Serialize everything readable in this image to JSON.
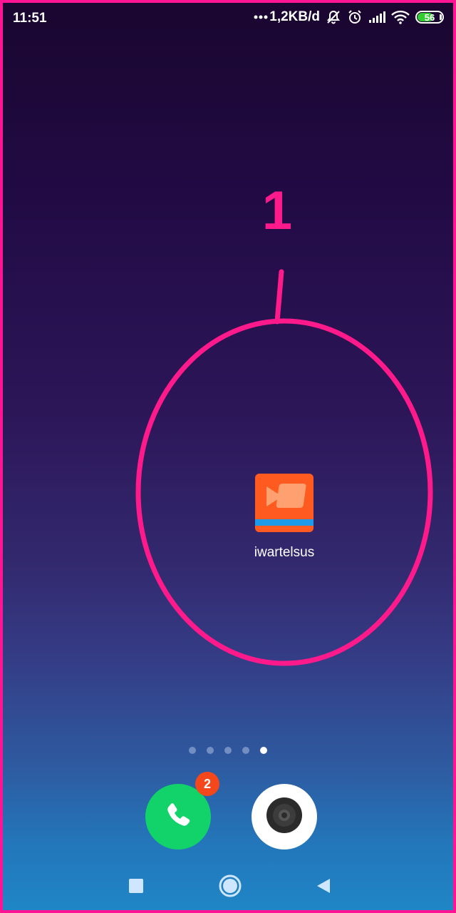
{
  "status_bar": {
    "time": "11:51",
    "network_speed": "1,2KB/d",
    "battery": "56",
    "icons": [
      "more-dots-icon",
      "mute-bell-icon",
      "alarm-icon",
      "signal-icon",
      "wifi-icon",
      "battery-icon"
    ]
  },
  "annotation": {
    "number": "1",
    "color": "#ff1a8c"
  },
  "home": {
    "app": {
      "label": "iwartelsus",
      "icon": "video-camera-icon"
    },
    "page_indicator": {
      "total": 5,
      "active_index": 4
    }
  },
  "dock": {
    "phone": {
      "icon": "phone-icon",
      "badge": "2"
    },
    "camera": {
      "icon": "camera-icon"
    }
  },
  "nav_bar": {
    "icons": [
      "recents-icon",
      "home-icon",
      "back-icon"
    ]
  }
}
